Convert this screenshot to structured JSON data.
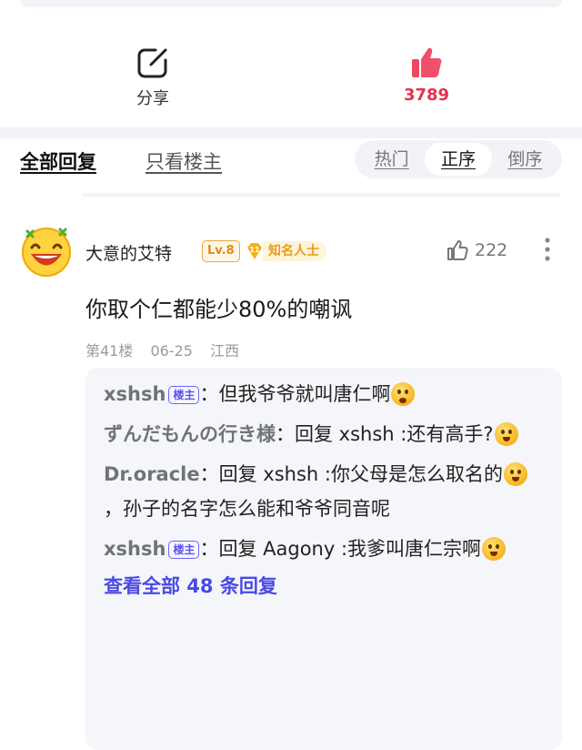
{
  "actions": {
    "share_label": "分享",
    "like_count": "3789"
  },
  "tabs": {
    "all": "全部回复",
    "only_lz": "只看楼主",
    "sort": [
      "热门",
      "正序",
      "倒序"
    ],
    "sort_active_index": 1
  },
  "post": {
    "username": "大意的艾特",
    "level": "Lv.8",
    "fame_level": "11",
    "fame_title": "知名人士",
    "likes": "222",
    "text": "你取个仁都能少80%的嘲讽",
    "floor": "第41楼",
    "date": "06-25",
    "location": "江西"
  },
  "replies": {
    "lz_tag": "楼主",
    "items": [
      {
        "name": "xshsh",
        "is_lz": true,
        "sep": "：",
        "text": "但我爷爷就叫唐仁啊",
        "emoji": "worried-face-emoji"
      },
      {
        "name": "ずんだもんの行き様",
        "is_lz": false,
        "sep": "：",
        "text": "回复 xshsh :还有高手?",
        "emoji": "laughing-face-emoji"
      },
      {
        "name": "Dr.oracle",
        "is_lz": false,
        "sep": "：",
        "text": "回复 xshsh :你父母是怎么取名的",
        "emoji": "laughing-face-emoji",
        "text_after": "，孙子的名字怎么能和爷爷同音呢"
      },
      {
        "name": "xshsh",
        "is_lz": true,
        "sep": "：",
        "text": "回复 Aagony :我爹叫唐仁宗啊",
        "emoji": "confused-face-emoji"
      }
    ],
    "view_all": "查看全部 48 条回复"
  },
  "colors": {
    "like_red": "#e8304d",
    "link_blue": "#4a49e6",
    "badge_orange": "#f0a43a",
    "lz_purple": "#5a52f0"
  }
}
